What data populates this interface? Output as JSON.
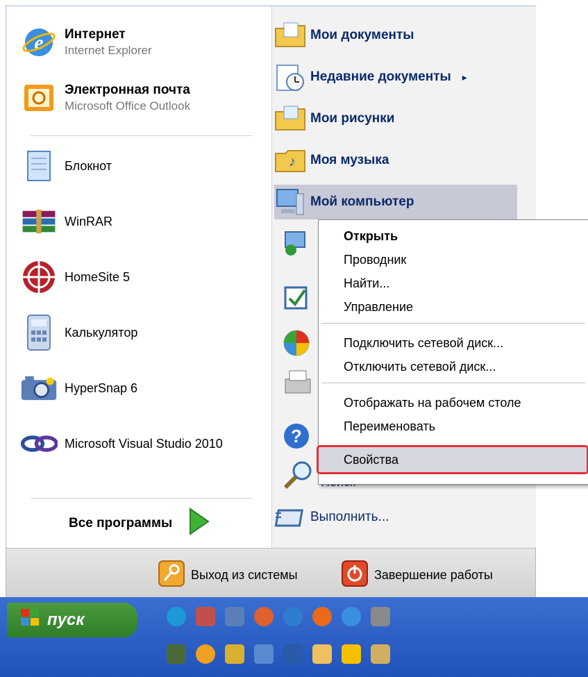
{
  "left": {
    "pinned": [
      {
        "title": "Интернет",
        "subtitle": "Internet Explorer",
        "icon": "internet-explorer-icon"
      },
      {
        "title": "Электронная почта",
        "subtitle": "Microsoft Office Outlook",
        "icon": "outlook-icon"
      }
    ],
    "apps": [
      {
        "label": "Блокнот",
        "icon": "notepad-icon"
      },
      {
        "label": "WinRAR",
        "icon": "winrar-icon"
      },
      {
        "label": "HomeSite 5",
        "icon": "homesite-icon"
      },
      {
        "label": "Калькулятор",
        "icon": "calculator-icon"
      },
      {
        "label": "HyperSnap 6",
        "icon": "camera-icon"
      },
      {
        "label": "Microsoft Visual Studio 2010",
        "icon": "visual-studio-icon"
      }
    ],
    "all_programs": "Все программы"
  },
  "right": {
    "items": [
      {
        "label": "Мои документы",
        "icon": "documents-folder-icon"
      },
      {
        "label": "Недавние документы",
        "icon": "recent-documents-icon",
        "arrow": "▸"
      },
      {
        "label": "Мои рисунки",
        "icon": "pictures-folder-icon"
      },
      {
        "label": "Моя музыка",
        "icon": "music-folder-icon"
      },
      {
        "label": "Мой компьютер",
        "icon": "my-computer-icon"
      }
    ],
    "partial_label": "Поиск",
    "run": "Выполнить..."
  },
  "context_menu": {
    "open": "Открыть",
    "explorer": "Проводник",
    "find": "Найти...",
    "manage": "Управление",
    "map_drive": "Подключить сетевой диск...",
    "disconnect_drive": "Отключить сетевой диск...",
    "show_desktop": "Отображать на рабочем столе",
    "rename": "Переименовать",
    "properties": "Свойства"
  },
  "footer": {
    "logoff": "Выход из системы",
    "shutdown": "Завершение работы"
  },
  "taskbar": {
    "start": "пуск"
  },
  "colors": {
    "highlight_border": "#e0303a",
    "link_blue": "#0b2a6a",
    "start_green": "#3b8a30"
  }
}
